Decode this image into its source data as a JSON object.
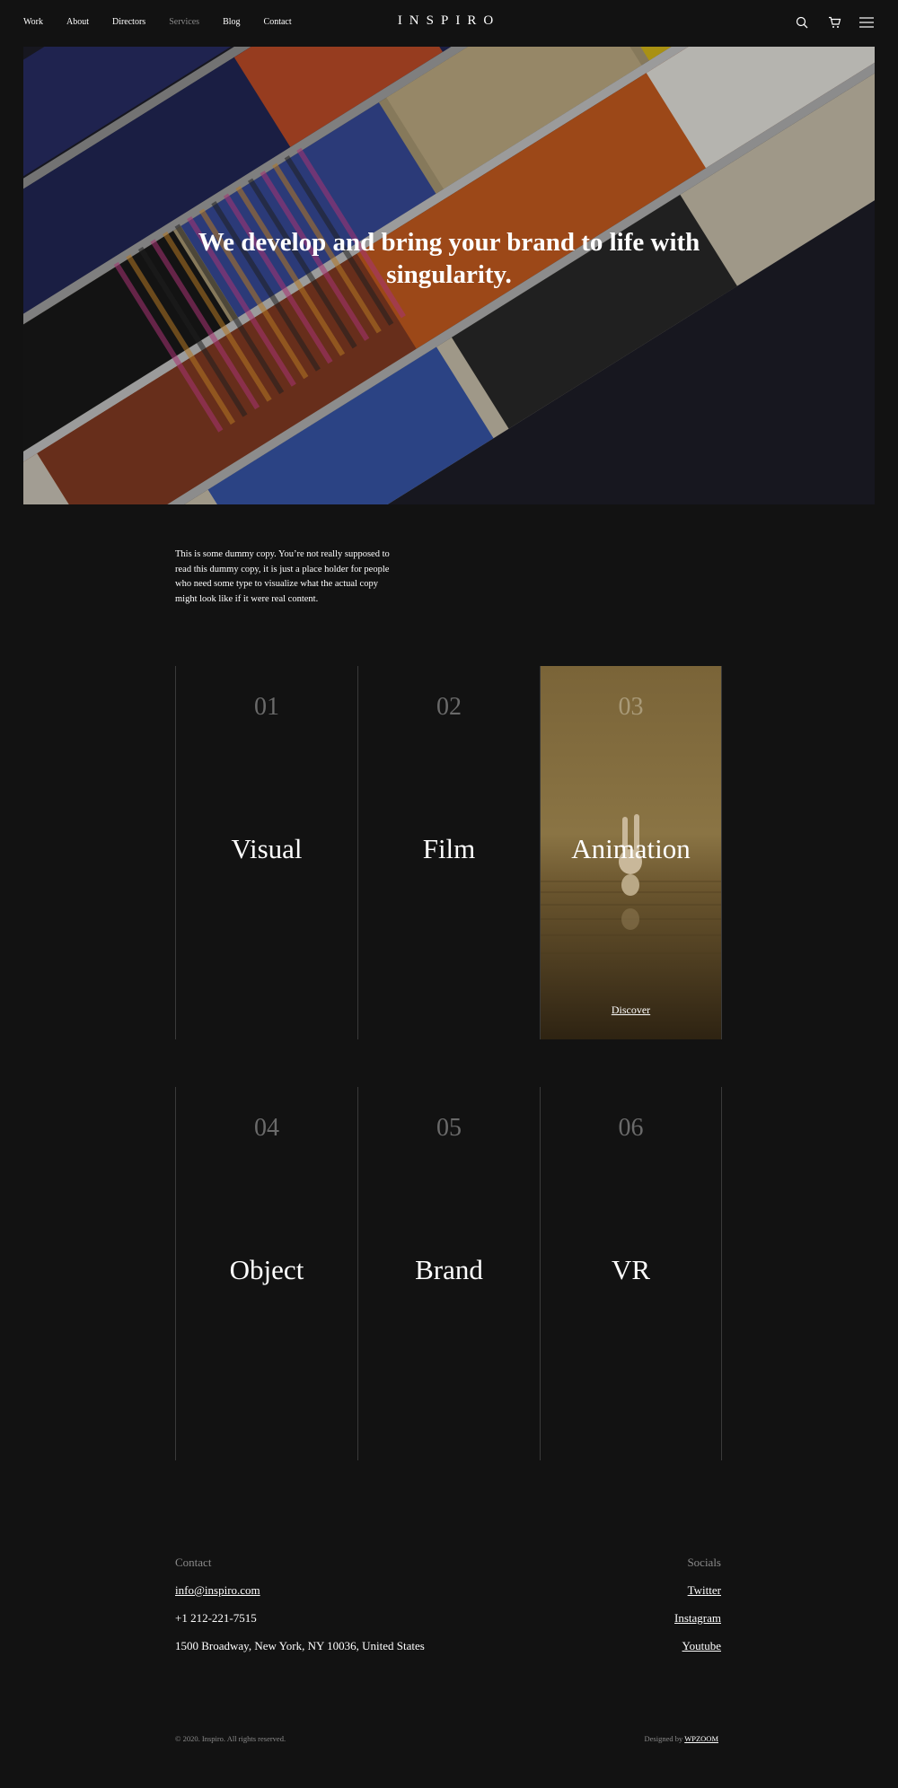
{
  "nav": {
    "items": [
      {
        "label": "Work"
      },
      {
        "label": "About"
      },
      {
        "label": "Directors"
      },
      {
        "label": "Services",
        "active": true
      },
      {
        "label": "Blog"
      },
      {
        "label": "Contact"
      }
    ]
  },
  "brand": {
    "logo": "INSPIRO"
  },
  "header_icons": [
    "search-icon",
    "cart-icon",
    "menu-icon"
  ],
  "hero": {
    "title": "We develop and bring your brand to life with singularity."
  },
  "intro": {
    "text": "This is some dummy copy. You’re not really supposed to read this dummy copy, it is just a place holder for people who need some type to visualize what the actual copy might look like if it were real content."
  },
  "services": [
    {
      "number": "01",
      "title": "Visual"
    },
    {
      "number": "02",
      "title": "Film"
    },
    {
      "number": "03",
      "title": "Animation",
      "link": "Discover"
    },
    {
      "number": "04",
      "title": "Object"
    },
    {
      "number": "05",
      "title": "Brand"
    },
    {
      "number": "06",
      "title": "VR"
    }
  ],
  "footer": {
    "contact_heading": "Contact",
    "email": "info@inspiro.com",
    "phone": "+1 212-221-7515",
    "address": "1500 Broadway, New York, NY 10036, United States",
    "socials_heading": "Socials",
    "socials": [
      "Twitter",
      "Instagram",
      "Youtube"
    ],
    "copyright": "© 2020. Inspiro. All rights reserved.",
    "designed_by_prefix": "Designed by",
    "designed_by_link": "WPZOOM"
  },
  "colors": {
    "background": "#121212",
    "text": "#ffffff",
    "muted": "#8a8a8a",
    "divider": "#3a3a3a"
  }
}
